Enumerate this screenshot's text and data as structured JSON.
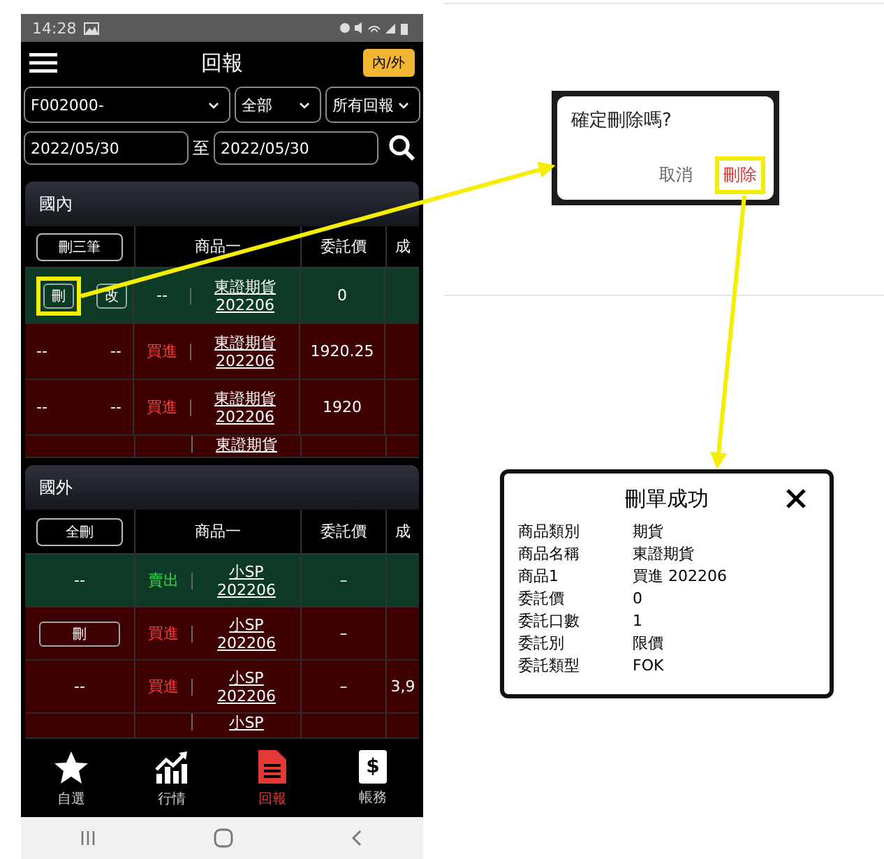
{
  "phone": {
    "status_bar": {
      "time": "14:28"
    },
    "header": {
      "title": "回報",
      "toggle": "內/外"
    },
    "filters": {
      "account": "F002000-",
      "category": "全部",
      "report": "所有回報",
      "date_from": "2022/05/30",
      "date_sep": "至",
      "date_to": "2022/05/30"
    },
    "sections": [
      {
        "title": "國內",
        "bulk_button": "刪三筆",
        "columns": [
          "商品一",
          "委託價",
          "成"
        ],
        "rows": [
          {
            "kind": "full",
            "color": "#0c3a24",
            "lead": [
              {
                "kind": "button",
                "label": "刪",
                "highlighted": true
              },
              {
                "kind": "button",
                "label": "改",
                "highlighted": false
              }
            ],
            "side": {
              "text": "--"
            },
            "product": [
              "東證期貨",
              "202206"
            ],
            "price": "0"
          },
          {
            "kind": "full",
            "color": "#3e0000",
            "lead": [
              {
                "kind": "text",
                "label": "--"
              },
              {
                "kind": "text",
                "label": "--"
              }
            ],
            "side": {
              "text": "買進",
              "color": "#ff3b3b"
            },
            "product": [
              "東證期貨",
              "202206"
            ],
            "price": "1920.25"
          },
          {
            "kind": "full",
            "color": "#3e0000",
            "lead": [
              {
                "kind": "text",
                "label": "--"
              },
              {
                "kind": "text",
                "label": "--"
              }
            ],
            "side": {
              "text": "買進",
              "color": "#ff3b3b"
            },
            "product": [
              "東證期貨",
              "202206"
            ],
            "price": "1920"
          },
          {
            "kind": "cut",
            "color": "#3e0000",
            "product": [
              "東證期貨"
            ]
          }
        ]
      },
      {
        "title": "國外",
        "bulk_button": "全刪",
        "columns": [
          "商品一",
          "委託價",
          "成"
        ],
        "rows": [
          {
            "kind": "full",
            "color": "#0c3a24",
            "lead": [
              {
                "kind": "text",
                "label": "--"
              }
            ],
            "side": {
              "text": "賣出",
              "color": "#2fe04a"
            },
            "product": [
              "小SP",
              "202206"
            ],
            "price": "–"
          },
          {
            "kind": "full",
            "color": "#3e0000",
            "lead": [
              {
                "kind": "button",
                "label": "刪",
                "highlighted": false
              }
            ],
            "side": {
              "text": "買進",
              "color": "#ff3b3b"
            },
            "product": [
              "小SP",
              "202206"
            ],
            "price": "–"
          },
          {
            "kind": "full",
            "color": "#3e0000",
            "lead": [
              {
                "kind": "text",
                "label": "--"
              }
            ],
            "side": {
              "text": "買進",
              "color": "#ff3b3b"
            },
            "product": [
              "小SP",
              "202206"
            ],
            "price": "–",
            "filled": "3,9"
          },
          {
            "kind": "cut",
            "color": "#3e0000",
            "product": [
              "小SP"
            ]
          }
        ]
      }
    ],
    "bottom_nav": [
      {
        "label": "自選",
        "selected": false
      },
      {
        "label": "行情",
        "selected": false
      },
      {
        "label": "回報",
        "selected": true
      },
      {
        "label": "帳務",
        "glyph": "$",
        "selected": false
      }
    ]
  },
  "confirm_dialog": {
    "message": "確定刪除嗎?",
    "buttons": [
      {
        "label": "取消",
        "kind": "cancel",
        "highlighted": false
      },
      {
        "label": "刪除",
        "kind": "danger",
        "highlighted": true
      }
    ]
  },
  "result_dialog": {
    "title": "刪單成功",
    "fields": [
      {
        "label": "商品類別",
        "value": "期貨"
      },
      {
        "label": "商品名稱",
        "value": "東證期貨"
      },
      {
        "label": "商品1",
        "value": "買進 202206"
      },
      {
        "label": "委託價",
        "value": "0"
      },
      {
        "label": "委託口數",
        "value": "1"
      },
      {
        "label": "委託別",
        "value": "限價"
      },
      {
        "label": "委託類型",
        "value": "FOK"
      }
    ]
  }
}
